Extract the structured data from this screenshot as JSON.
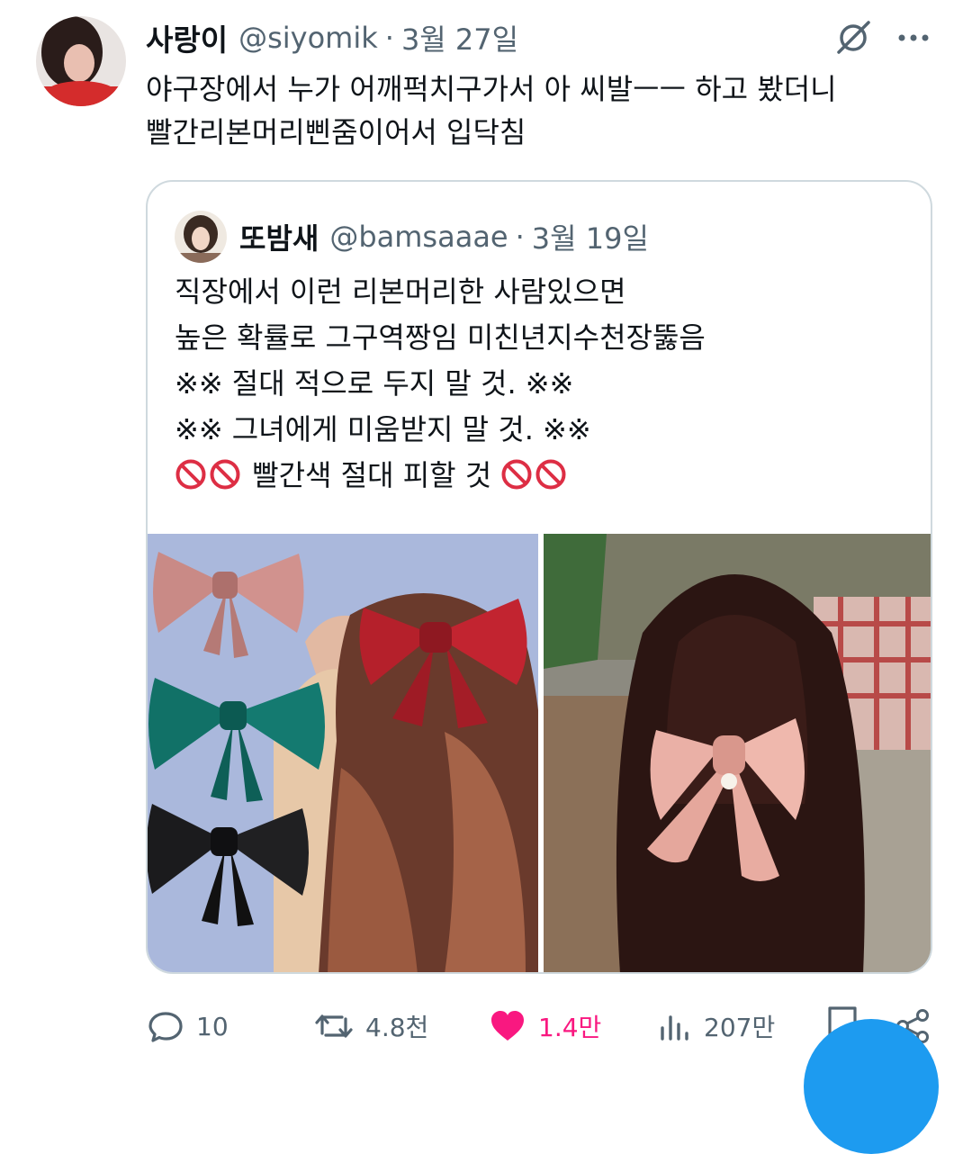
{
  "tweet": {
    "author_name": "사랑이",
    "handle": "@siyomik",
    "separator": "·",
    "date": "3월 27일",
    "text": "야구장에서 누가 어깨퍽치구가서 아 씨발ㅡㅡ 하고 봤더니\n빨간리본머리삔줌이어서 입닥침"
  },
  "quote": {
    "author_name": "또밤새",
    "handle": "@bamsaaae",
    "separator": "·",
    "date": "3월 19일",
    "lines": [
      "직장에서 이런 리본머리한 사람있으면",
      "높은 확률로 그구역짱임 미친년지수천장뚫음",
      "※※ 절대 적으로 두지 말 것. ※※",
      "※※ 그녀에게 미움받지 말 것. ※※",
      "빨간색 절대 피할 것"
    ]
  },
  "actions": {
    "replies": "10",
    "retweets": "4.8천",
    "likes": "1.4만",
    "views": "207만"
  },
  "colors": {
    "like_active": "#f91880",
    "secondary_text": "#536471",
    "border": "#cfd9de",
    "accent": "#1d9bf0"
  },
  "icons": [
    "grok-icon",
    "more-icon",
    "reply-icon",
    "retweet-icon",
    "like-icon",
    "views-icon",
    "bookmark-icon",
    "share-icon",
    "no-entry-icon"
  ]
}
